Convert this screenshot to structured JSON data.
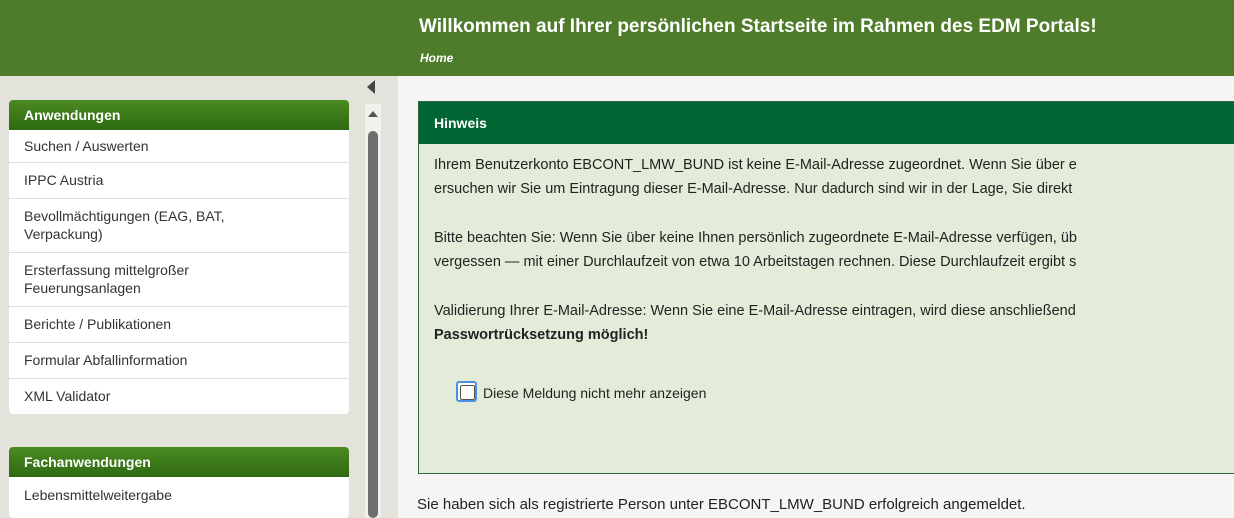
{
  "header": {
    "title": "Willkommen auf Ihrer persönlichen Startseite im Rahmen des EDM Portals!",
    "breadcrumb": "Home"
  },
  "sidebar": {
    "applications": {
      "title": "Anwendungen",
      "items": [
        "Suchen / Auswerten",
        "IPPC Austria",
        "Bevollmächtigungen (EAG, BAT, Verpackung)",
        "Ersterfassung mittelgroßer Feuerungsanlagen",
        "Berichte / Publikationen",
        "Formular Abfallinformation",
        "XML Validator"
      ]
    },
    "specialist": {
      "title": "Fachanwendungen",
      "items": [
        "Lebensmittelweitergabe"
      ]
    }
  },
  "notice": {
    "title": "Hinweis",
    "p1_line1": "Ihrem Benutzerkonto EBCONT_LMW_BUND ist keine E-Mail-Adresse zugeordnet. Wenn Sie über e",
    "p1_line2": "ersuchen wir Sie um Eintragung dieser E-Mail-Adresse. Nur dadurch sind wir in der Lage, Sie direkt",
    "p2_line1": "Bitte beachten Sie: Wenn Sie über keine Ihnen persönlich zugeordnete E-Mail-Adresse verfügen, üb",
    "p2_line2": "vergessen — mit einer Durchlaufzeit von etwa 10 Arbeitstagen rechnen. Diese Durchlaufzeit ergibt s",
    "p3_line1": "Validierung Ihrer E-Mail-Adresse: Wenn Sie eine E-Mail-Adresse eintragen, wird diese anschließend",
    "p3_line2": "Passwortrücksetzung möglich!",
    "checkbox_label": "Diese Meldung nicht mehr anzeigen",
    "checkbox_checked": false
  },
  "login_message": "Sie haben sich als registrierte Person unter EBCONT_LMW_BUND erfolgreich angemeldet.",
  "colors": {
    "header": "#4e7c2a",
    "panel_head": "#3d7a1a",
    "notice_head": "#006633",
    "notice_bg": "#e4ecd9"
  }
}
